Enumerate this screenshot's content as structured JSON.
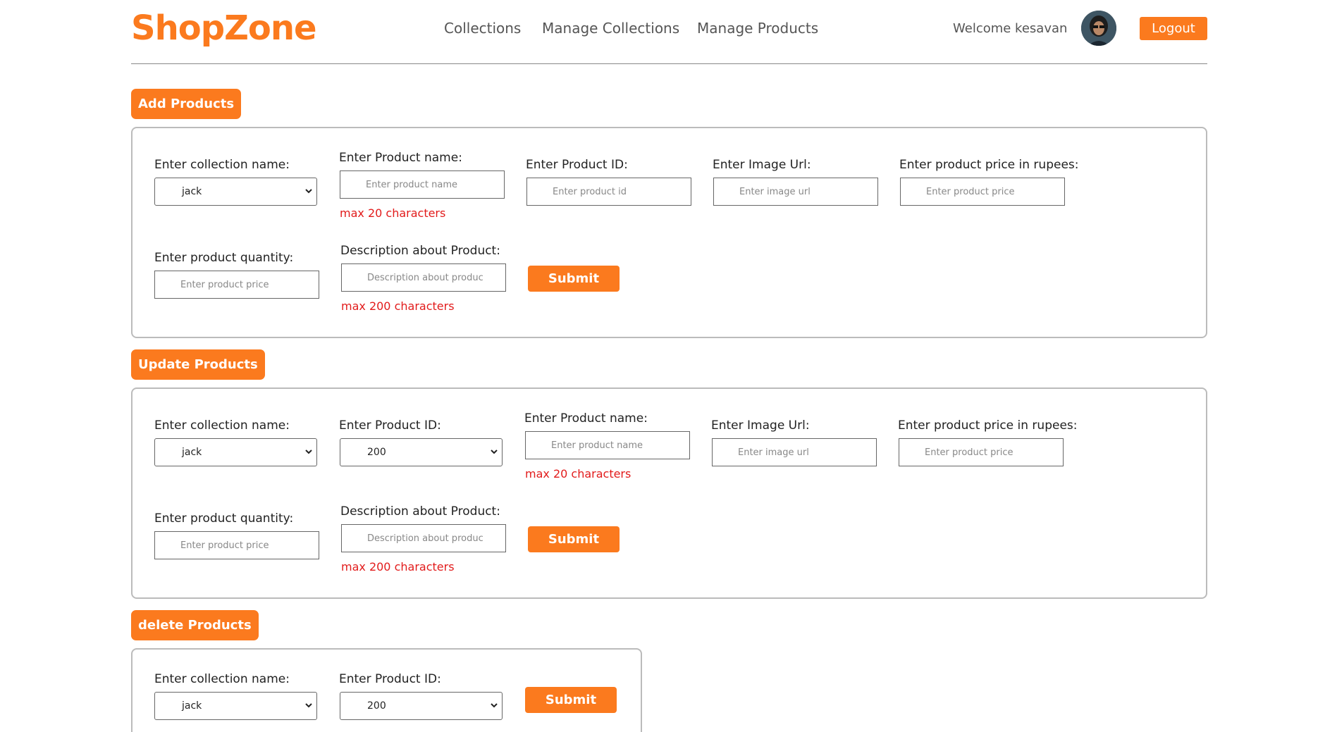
{
  "header": {
    "logo": "ShopZone",
    "nav": [
      "Collections",
      "Manage Collections",
      "Manage Products"
    ],
    "welcome": "Welcome kesavan",
    "logout": "Logout"
  },
  "add": {
    "title": "Add Products",
    "collection_label": "Enter collection name:",
    "collection_value": "jack",
    "name_label": "Enter Product name:",
    "name_placeholder": "Enter product name",
    "name_hint": "max 20 characters",
    "id_label": "Enter Product ID:",
    "id_placeholder": "Enter product id",
    "image_label": "Enter Image Url:",
    "image_placeholder": "Enter image url",
    "price_label": "Enter product price in rupees:",
    "price_placeholder": "Enter product price",
    "qty_label": "Enter product quantity:",
    "qty_placeholder": "Enter product price",
    "desc_label": "Description about Product:",
    "desc_placeholder": "Description about produc",
    "desc_hint": "max 200 characters",
    "submit": "Submit"
  },
  "update": {
    "title": "Update Products",
    "collection_label": "Enter collection name:",
    "collection_value": "jack",
    "id_label": "Enter Product ID:",
    "id_value": "200",
    "name_label": "Enter Product name:",
    "name_placeholder": "Enter product name",
    "name_hint": "max 20 characters",
    "image_label": "Enter Image Url:",
    "image_placeholder": "Enter image url",
    "price_label": "Enter product price in rupees:",
    "price_placeholder": "Enter product price",
    "qty_label": "Enter product quantity:",
    "qty_placeholder": "Enter product price",
    "desc_label": "Description about Product:",
    "desc_placeholder": "Description about produc",
    "desc_hint": "max 200 characters",
    "submit": "Submit"
  },
  "delete": {
    "title": "delete Products",
    "collection_label": "Enter collection name:",
    "collection_value": "jack",
    "id_label": "Enter Product ID:",
    "id_value": "200",
    "submit": "Submit"
  },
  "colors": {
    "accent": "#fb7a1e",
    "hint": "#e21b1b",
    "border": "#bbbbbb"
  }
}
